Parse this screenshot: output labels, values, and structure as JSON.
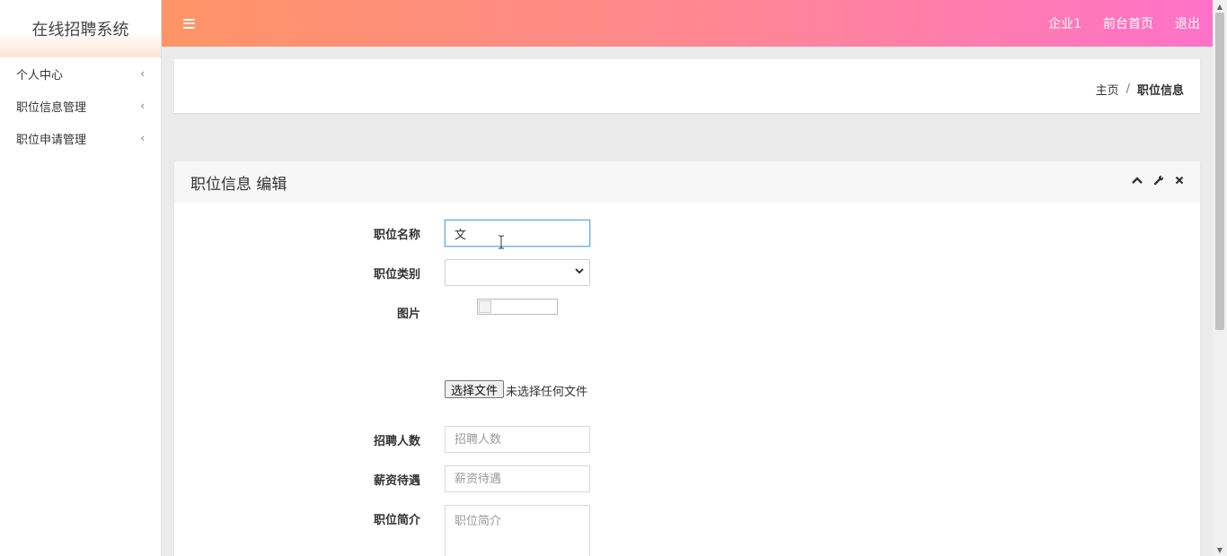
{
  "sidebar": {
    "brand": "在线招聘系统",
    "items": [
      {
        "label": "个人中心"
      },
      {
        "label": "职位信息管理"
      },
      {
        "label": "职位申请管理"
      }
    ]
  },
  "topbar": {
    "links": [
      "企业1",
      "前台首页",
      "退出"
    ]
  },
  "breadcrumb": {
    "home": "主页",
    "separator": "/",
    "current": "职位信息"
  },
  "panel": {
    "title": "职位信息 编辑"
  },
  "form": {
    "job_name": {
      "label": "职位名称",
      "value": "文"
    },
    "job_category": {
      "label": "职位类别",
      "value": ""
    },
    "image": {
      "label": "图片"
    },
    "file": {
      "button": "选择文件",
      "status": "未选择任何文件"
    },
    "headcount": {
      "label": "招聘人数",
      "placeholder": "招聘人数"
    },
    "salary": {
      "label": "薪资待遇",
      "placeholder": "薪资待遇"
    },
    "intro": {
      "label": "职位简介",
      "placeholder": "职位简介"
    }
  },
  "colors": {
    "topbar_start": "#ff9466",
    "topbar_end": "#ff72c8",
    "focus_border": "#66afe9"
  }
}
